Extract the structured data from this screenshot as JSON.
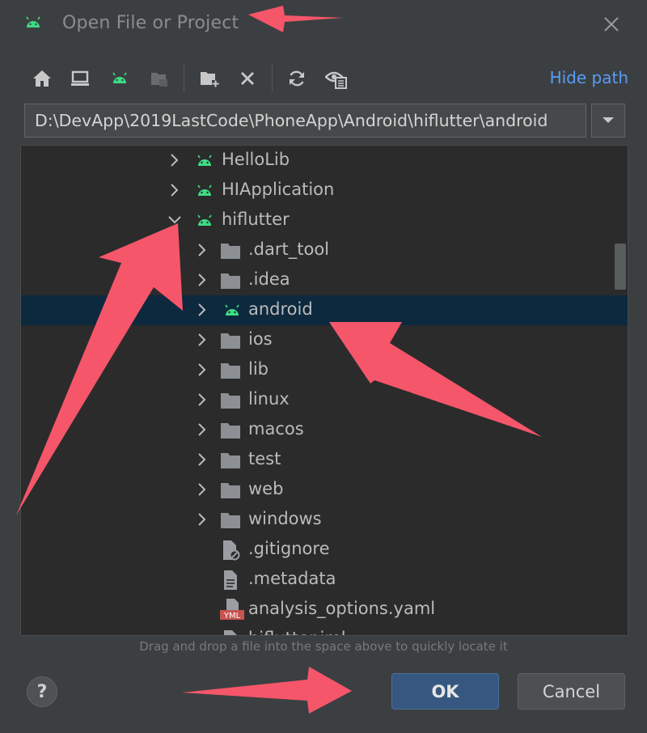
{
  "window": {
    "title": "Open File or Project",
    "close_icon": "close-icon"
  },
  "toolbar": {
    "buttons": [
      {
        "icon": "home-icon"
      },
      {
        "icon": "desktop-icon"
      },
      {
        "icon": "android-project-icon"
      },
      {
        "icon": "module-icon"
      },
      {
        "icon": "new-folder-icon"
      },
      {
        "icon": "delete-icon"
      },
      {
        "icon": "refresh-icon"
      },
      {
        "icon": "show-hidden-icon"
      }
    ],
    "hide_path_label": "Hide path"
  },
  "path": {
    "value": "D:\\DevApp\\2019LastCode\\PhoneApp\\Android\\hiflutter\\android"
  },
  "tree": {
    "items": [
      {
        "label": "HelloLib",
        "icon": "android-icon",
        "expanded": false
      },
      {
        "label": "HIApplication",
        "icon": "android-icon",
        "expanded": false
      },
      {
        "label": "hiflutter",
        "icon": "android-icon",
        "expanded": true
      },
      {
        "label": ".dart_tool",
        "icon": "folder-icon",
        "expanded": false
      },
      {
        "label": ".idea",
        "icon": "folder-icon",
        "expanded": false
      },
      {
        "label": "android",
        "icon": "android-icon",
        "expanded": false,
        "selected": true
      },
      {
        "label": "ios",
        "icon": "folder-icon",
        "expanded": false
      },
      {
        "label": "lib",
        "icon": "folder-icon",
        "expanded": false
      },
      {
        "label": "linux",
        "icon": "folder-icon",
        "expanded": false
      },
      {
        "label": "macos",
        "icon": "folder-icon",
        "expanded": false
      },
      {
        "label": "test",
        "icon": "folder-icon",
        "expanded": false
      },
      {
        "label": "web",
        "icon": "folder-icon",
        "expanded": false
      },
      {
        "label": "windows",
        "icon": "folder-icon",
        "expanded": false
      },
      {
        "label": ".gitignore",
        "icon": "ignored-file-icon"
      },
      {
        "label": ".metadata",
        "icon": "text-file-icon"
      },
      {
        "label": "analysis_options.yaml",
        "icon": "yaml-file-icon",
        "badge": "YML"
      },
      {
        "label": "hiflutter.iml",
        "icon": "iml-file-icon"
      }
    ]
  },
  "hint": "Drag and drop a file into the space above to quickly locate it",
  "buttons": {
    "help": "?",
    "ok": "OK",
    "cancel": "Cancel"
  },
  "colors": {
    "background": "#3c3f41",
    "tree_background": "#2b2b2b",
    "selection": "#0d293e",
    "accent_link": "#589df6",
    "android_green": "#3ddc84",
    "annotation_arrow": "#f5566a",
    "ok_button": "#365880"
  }
}
